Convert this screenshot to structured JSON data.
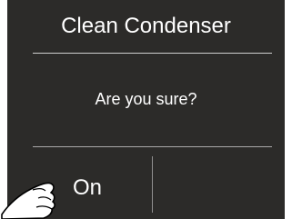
{
  "dialog": {
    "title": "Clean Condenser",
    "message": "Are you sure?",
    "confirm_label": "On",
    "cancel_label": ""
  },
  "colors": {
    "screen_background": "#2c2b29",
    "text": "#ffffff",
    "divider": "#cfcfcf",
    "finger_fill": "#ffffff",
    "finger_outline": "#000000"
  },
  "icons": {
    "pointer": "finger-pointer-icon"
  }
}
